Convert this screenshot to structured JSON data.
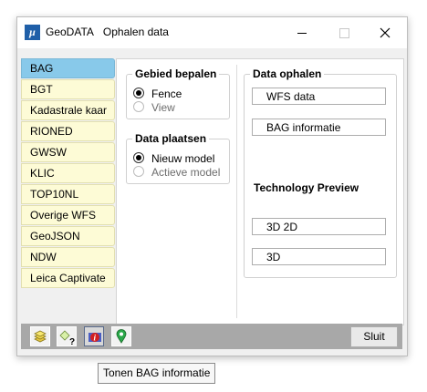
{
  "window": {
    "app_name": "GeoDATA",
    "title": "Ophalen data",
    "logo_text": "μ"
  },
  "sidebar": {
    "items": [
      {
        "label": "BAG",
        "active": true
      },
      {
        "label": "BGT",
        "active": false
      },
      {
        "label": "Kadastrale kaar",
        "active": false
      },
      {
        "label": "RIONED",
        "active": false
      },
      {
        "label": "GWSW",
        "active": false
      },
      {
        "label": "KLIC",
        "active": false
      },
      {
        "label": "TOP10NL",
        "active": false
      },
      {
        "label": "Overige WFS",
        "active": false
      },
      {
        "label": "GeoJSON",
        "active": false
      },
      {
        "label": "NDW",
        "active": false
      },
      {
        "label": "Leica Captivate",
        "active": false
      }
    ]
  },
  "gebied": {
    "title": "Gebied bepalen",
    "options": [
      {
        "label": "Fence",
        "checked": true,
        "enabled": true
      },
      {
        "label": "View",
        "checked": false,
        "enabled": false
      }
    ]
  },
  "plaatsen": {
    "title": "Data plaatsen",
    "options": [
      {
        "label": "Nieuw model",
        "checked": true,
        "enabled": true
      },
      {
        "label": "Actieve model",
        "checked": false,
        "enabled": false
      }
    ]
  },
  "ophalen": {
    "title": "Data ophalen",
    "buttons": [
      "WFS data",
      "BAG informatie"
    ]
  },
  "preview": {
    "title": "Technology Preview",
    "buttons": [
      "3D 2D",
      "3D"
    ]
  },
  "bottombar": {
    "tools": [
      "layers-icon",
      "help-query-icon",
      "info-icon",
      "location-pin-icon"
    ],
    "close_label": "Sluit"
  },
  "tooltip": {
    "text": "Tonen BAG informatie"
  },
  "colors": {
    "active_tab": "#88c9ea",
    "inactive_tab": "#fdfbd6",
    "bottom_bar": "#a8a8a8"
  }
}
